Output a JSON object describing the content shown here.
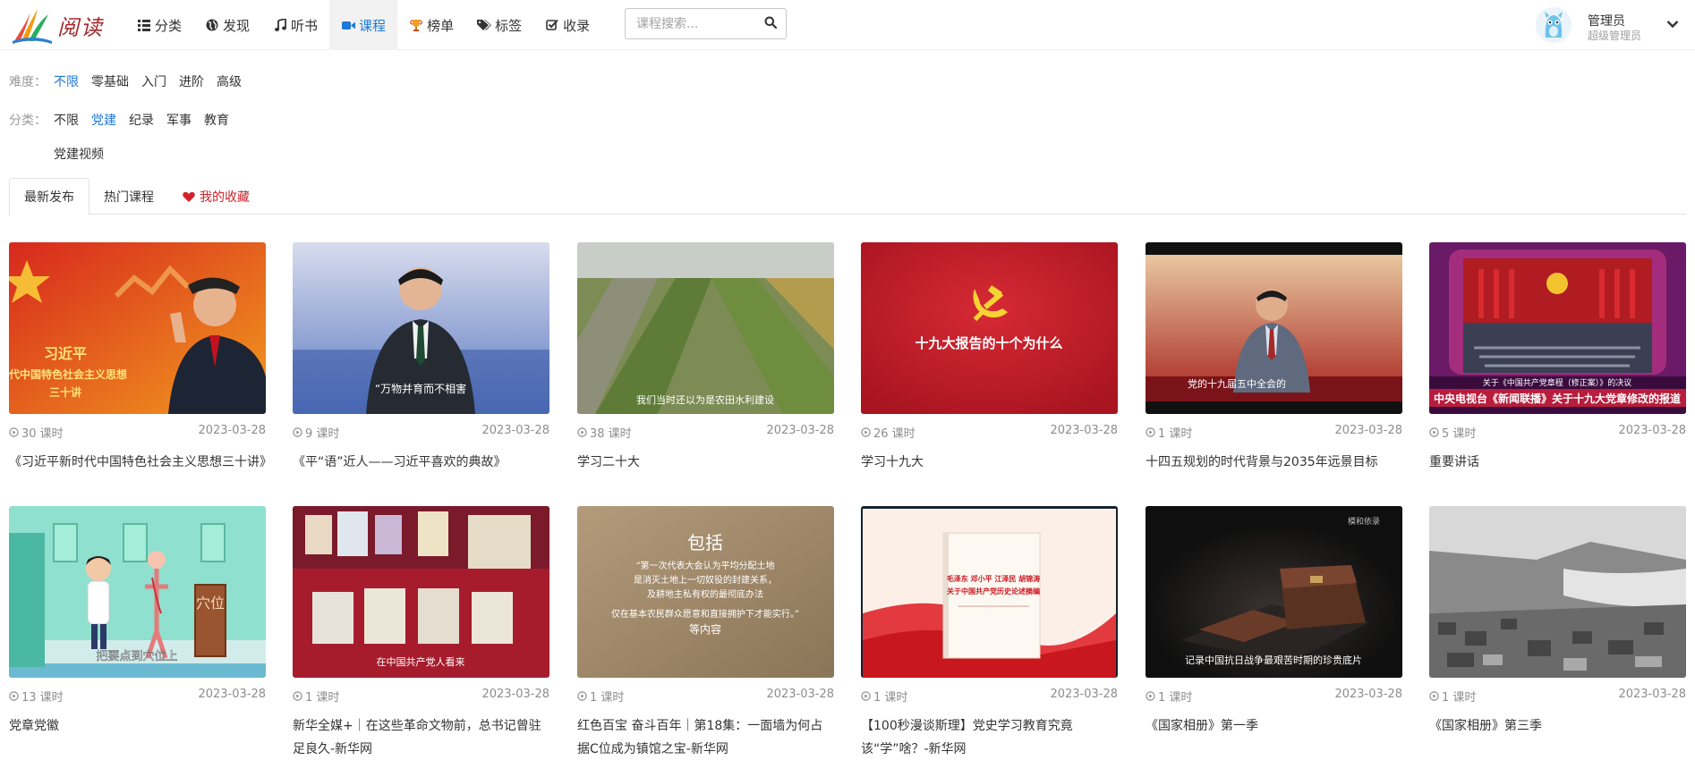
{
  "app": {
    "logo_text": "阅读"
  },
  "nav": {
    "items": [
      {
        "label": "分类",
        "icon": "list-icon"
      },
      {
        "label": "发现",
        "icon": "globe-icon"
      },
      {
        "label": "听书",
        "icon": "music-icon"
      },
      {
        "label": "课程",
        "icon": "video-icon",
        "active": true
      },
      {
        "label": "榜单",
        "icon": "trophy-icon"
      },
      {
        "label": "标签",
        "icon": "tags-icon"
      },
      {
        "label": "收录",
        "icon": "check-square-icon"
      }
    ],
    "search": {
      "placeholder": "课程搜索...",
      "value": ""
    }
  },
  "user": {
    "name": "管理员",
    "role": "超级管理员"
  },
  "filters": {
    "difficulty": {
      "label": "难度：",
      "options": [
        "不限",
        "零基础",
        "入门",
        "进阶",
        "高级"
      ],
      "selected": "不限"
    },
    "category": {
      "label": "分类：",
      "options": [
        "不限",
        "党建",
        "纪录",
        "军事",
        "教育"
      ],
      "selected": "党建"
    },
    "subcategory": {
      "options": [
        "党建视频"
      ]
    }
  },
  "tabs": [
    {
      "label": "最新发布",
      "active": true
    },
    {
      "label": "热门课程"
    },
    {
      "label": "我的收藏",
      "icon": "heart-icon"
    }
  ],
  "colors": {
    "accent": "#1e78d7",
    "favorite": "#d0232b"
  },
  "courses": [
    {
      "lessons": "30 课时",
      "date": "2023-03-28",
      "title": "《习近平新时代中国特色社会主义思想三十讲》",
      "thumb_text": [
        "习近平",
        "时代中国特色社会主义思想",
        "三十讲"
      ]
    },
    {
      "lessons": "9 课时",
      "date": "2023-03-28",
      "title": "《平“语”近人——习近平喜欢的典故》",
      "thumb_text": [
        "“万物并育而不相害"
      ]
    },
    {
      "lessons": "38 课时",
      "date": "2023-03-28",
      "title": "学习二十大",
      "thumb_text": [
        "我们当时还以为是农田水利建设"
      ]
    },
    {
      "lessons": "26 课时",
      "date": "2023-03-28",
      "title": "学习十九大",
      "thumb_text": [
        "十九大报告的十个为什么"
      ]
    },
    {
      "lessons": "1 课时",
      "date": "2023-03-28",
      "title": "十四五规划的时代背景与2035年远景目标",
      "thumb_text": [
        "党的十九届五中全会的"
      ]
    },
    {
      "lessons": "5 课时",
      "date": "2023-03-28",
      "title": "重要讲话",
      "thumb_text": [
        "关于《中国共产党章程（修正案）》的决议",
        "中央电视台《新闻联播》关于十九大党章修改的报道"
      ]
    },
    {
      "lessons": "13 课时",
      "date": "2023-03-28",
      "title": "党章党徽",
      "thumb_text": [
        "把要点到穴位上",
        "穴位"
      ]
    },
    {
      "lessons": "1 课时",
      "date": "2023-03-28",
      "title": "新华全媒+｜在这些革命文物前，总书记曾驻足良久-新华网",
      "thumb_text": [
        "在中国共产党人看来"
      ]
    },
    {
      "lessons": "1 课时",
      "date": "2023-03-28",
      "title": "红色百宝 奋斗百年｜第18集：一面墙为何占据C位成为镇馆之宝-新华网",
      "thumb_text": [
        "包括",
        "“第一次代表大会认为平均分配土地",
        "是消灭土地上一切奴役的封建关系，",
        "及耕地主私有权的最彻底办法",
        "仅在基本农民群众愿意和直接拥护下才能实行。”",
        "等内容"
      ]
    },
    {
      "lessons": "1 课时",
      "date": "2023-03-28",
      "title": "【100秒漫谈斯理】党史学习教育究竟该“学”啥？-新华网",
      "thumb_text": [
        "毛泽东 邓小平 江泽民 胡锦涛",
        "关于中国共产党历史论述摘编"
      ]
    },
    {
      "lessons": "1 课时",
      "date": "2023-03-28",
      "title": "《国家相册》第一季",
      "thumb_text": [
        "记录中国抗日战争最艰苦时期的珍贵底片",
        "模和依录"
      ]
    },
    {
      "lessons": "1 课时",
      "date": "2023-03-28",
      "title": "《国家相册》第三季",
      "thumb_text": []
    }
  ]
}
